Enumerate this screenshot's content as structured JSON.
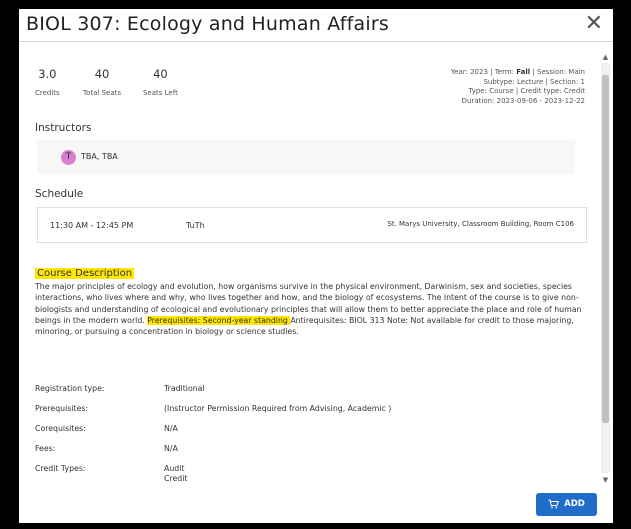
{
  "modal": {
    "title": "BIOL 307: Ecology and Human Affairs",
    "close_icon": "close-icon",
    "add_label": "ADD",
    "cart_icon": "cart-icon"
  },
  "stats": [
    {
      "value": "3.0",
      "label": "Credits"
    },
    {
      "value": "40",
      "label": "Total Seats"
    },
    {
      "value": "40",
      "label": "Seats Left"
    }
  ],
  "meta": {
    "line1_prefix": "Year: 2023 | Term: ",
    "term": "Fall",
    "line1_suffix": " | Session: Main",
    "line2": "Subtype: Lecture | Section: 1",
    "line3": "Type: Course | Credit type: Credit",
    "line4": "Duration: 2023-09-06 - 2023-12-22"
  },
  "instructors": {
    "heading": "Instructors",
    "avatar_letter": "T",
    "name": "TBA, TBA"
  },
  "schedule": {
    "heading": "Schedule",
    "time": "11:30 AM - 12:45 PM",
    "days": "TuTh",
    "location": "St. Marys University, Classroom Building, Room C106"
  },
  "description": {
    "heading": "Course Description",
    "text_before": "The major principles of ecology and evolution, how organisms survive in the physical environment, Darwinism, sex and societies, species interactions, who lives where and why, who lives together and how, and the biology of ecosystems. The intent of the course is to give non-biologists and understanding of ecological and evolutionary principles that will allow them to better appreciate the place and role of human beings in the modern world. ",
    "highlight": "Prerequisites: Second-year standing ",
    "text_after": "Antirequisites: BIOL 313 Note: Not available for credit to those majoring, minoring, or pursuing a concentration in biology or science studies."
  },
  "registration": {
    "rows": [
      {
        "key": "Registration type:",
        "value": "Traditional"
      },
      {
        "key": "Prerequisites:",
        "value": "(Instructor Permission Required from Advising, Academic )"
      },
      {
        "key": "Corequisites:",
        "value": "N/A"
      },
      {
        "key": "Fees:",
        "value": "N/A"
      },
      {
        "key": "Credit Types:",
        "value": "Audit"
      }
    ],
    "credit_extra": "Credit"
  }
}
